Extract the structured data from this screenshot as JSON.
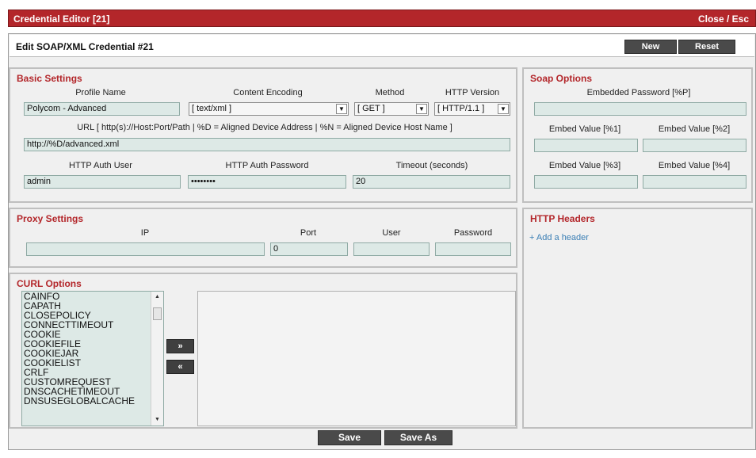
{
  "window": {
    "title": "Credential Editor [21]",
    "close_label": "Close / Esc"
  },
  "header": {
    "title": "Edit SOAP/XML Credential #21",
    "new_label": "New",
    "reset_label": "Reset"
  },
  "basic": {
    "title": "Basic Settings",
    "profile_name_label": "Profile Name",
    "profile_name_value": "Polycom - Advanced",
    "content_encoding_label": "Content Encoding",
    "content_encoding_value": "[ text/xml ]",
    "method_label": "Method",
    "method_value": "[ GET ]",
    "http_version_label": "HTTP Version",
    "http_version_value": "[ HTTP/1.1 ]",
    "url_label": "URL [ http(s)://Host:Port/Path | %D = Aligned Device Address | %N = Aligned Device Host Name ]",
    "url_value": "http://%D/advanced.xml",
    "auth_user_label": "HTTP Auth User",
    "auth_user_value": "admin",
    "auth_password_label": "HTTP Auth Password",
    "auth_password_value": "••••••••",
    "timeout_label": "Timeout (seconds)",
    "timeout_value": "20"
  },
  "soap": {
    "title": "Soap Options",
    "embedded_password_label": "Embedded Password [%P]",
    "embedded_password_value": "",
    "embed1_label": "Embed Value [%1]",
    "embed1_value": "",
    "embed2_label": "Embed Value [%2]",
    "embed2_value": "",
    "embed3_label": "Embed Value [%3]",
    "embed3_value": "",
    "embed4_label": "Embed Value [%4]",
    "embed4_value": ""
  },
  "proxy": {
    "title": "Proxy Settings",
    "ip_label": "IP",
    "ip_value": "",
    "port_label": "Port",
    "port_value": "0",
    "user_label": "User",
    "user_value": "",
    "password_label": "Password",
    "password_value": ""
  },
  "http_headers": {
    "title": "HTTP Headers",
    "add_icon": "plus-icon",
    "add_label": "Add a header"
  },
  "curl": {
    "title": "CURL Options",
    "options": [
      "CAINFO",
      "CAPATH",
      "CLOSEPOLICY",
      "CONNECTTIMEOUT",
      "COOKIE",
      "COOKIEFILE",
      "COOKIEJAR",
      "COOKIELIST",
      "CRLF",
      "CUSTOMREQUEST",
      "DNSCACHETIMEOUT",
      "DNSUSEGLOBALCACHE"
    ],
    "add_arrow": "»",
    "remove_arrow": "«"
  },
  "footer": {
    "save_label": "Save",
    "save_as_label": "Save As"
  },
  "colors": {
    "accent": "#b3262a",
    "field_bg": "#dde9e6",
    "link": "#3b7fb5"
  }
}
